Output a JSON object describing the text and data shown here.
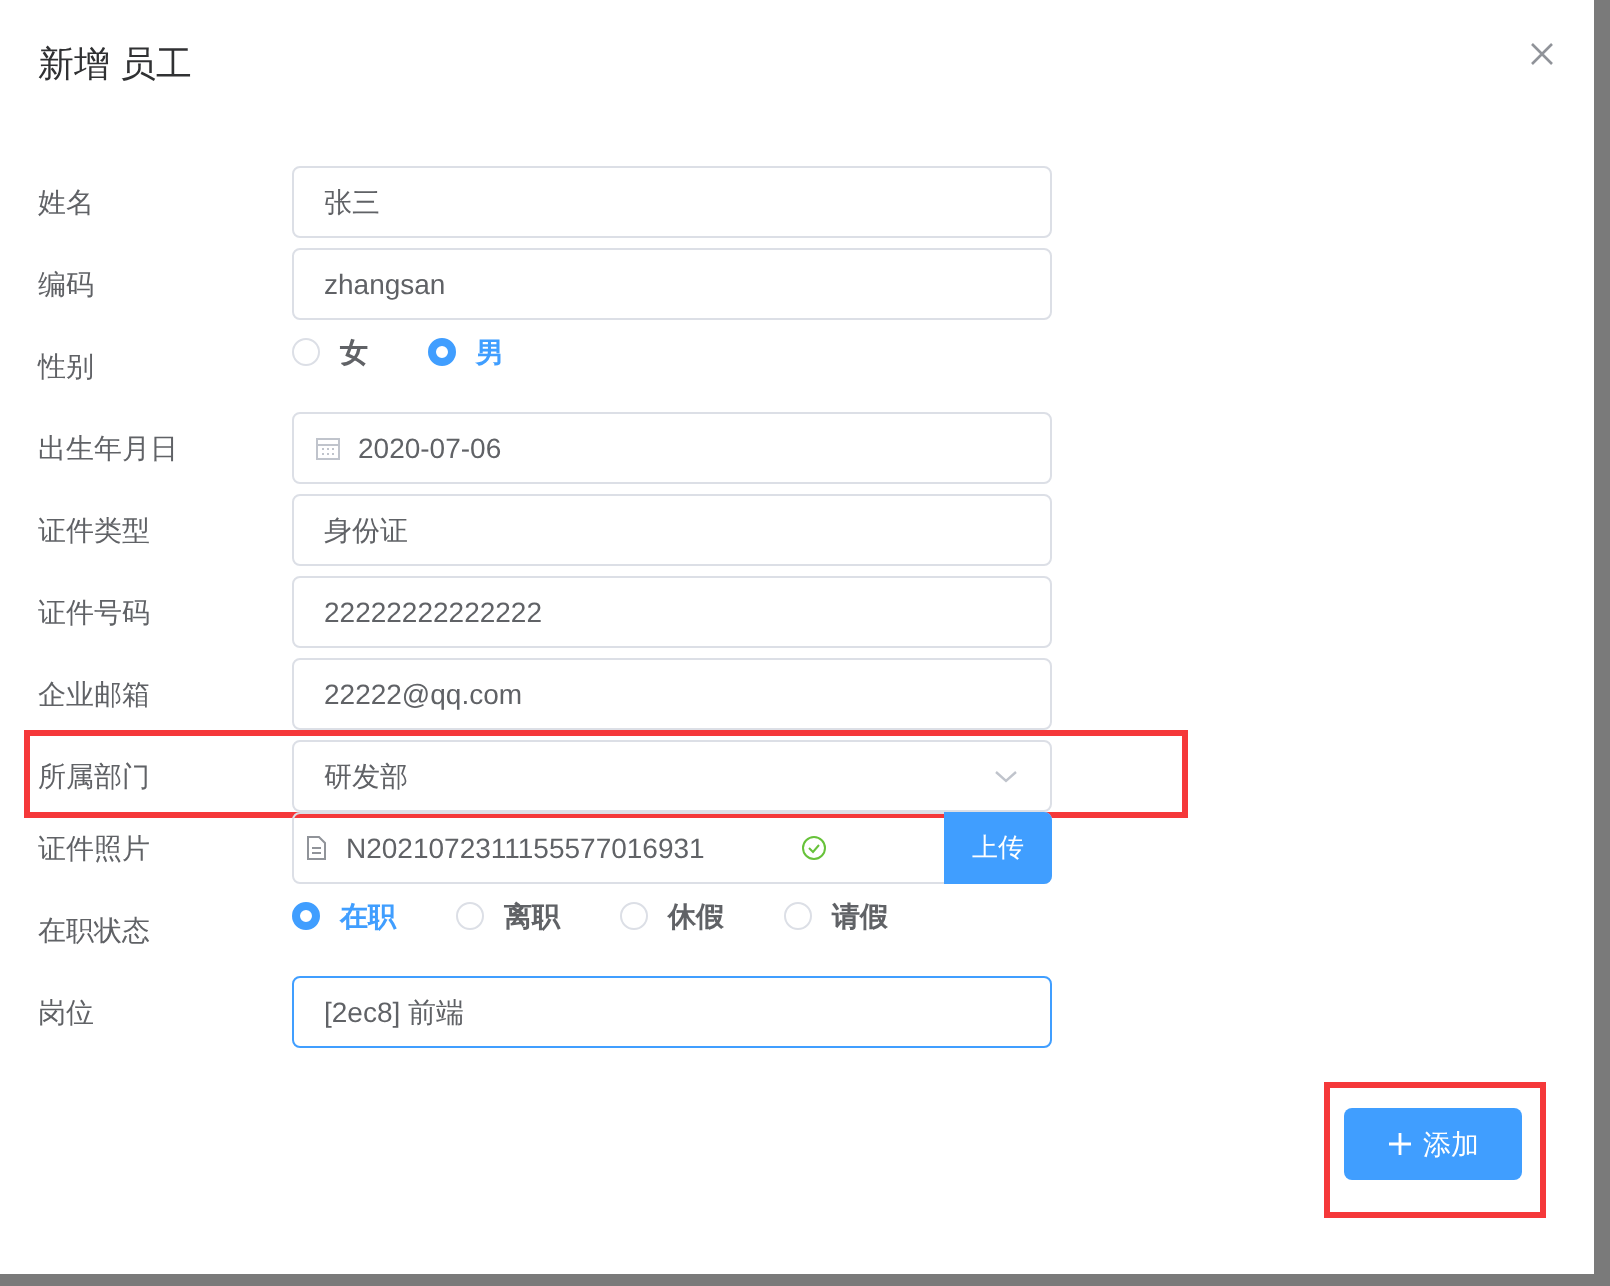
{
  "dialog": {
    "title": "新增 员工"
  },
  "fields": [
    {
      "kind": "input",
      "label": "姓名",
      "value": "张三"
    },
    {
      "kind": "input",
      "label": "编码",
      "value": "zhangsan"
    },
    {
      "kind": "radio",
      "label": "性别",
      "options": [
        {
          "label": "女",
          "selected": false
        },
        {
          "label": "男",
          "selected": true
        }
      ]
    },
    {
      "kind": "date",
      "label": "出生年月日",
      "value": "2020-07-06"
    },
    {
      "kind": "input",
      "label": "证件类型",
      "value": "身份证"
    },
    {
      "kind": "input",
      "label": "证件号码",
      "value": "22222222222222"
    },
    {
      "kind": "input",
      "label": "企业邮箱",
      "value": "22222@qq.com"
    },
    {
      "kind": "select",
      "label": "所属部门",
      "value": "研发部",
      "highlighted": true
    },
    {
      "kind": "upload",
      "label": "证件照片",
      "value": "N2021072311155577016931",
      "uploaded": true,
      "button": "上传"
    },
    {
      "kind": "radio",
      "label": "在职状态",
      "options": [
        {
          "label": "在职",
          "selected": true
        },
        {
          "label": "离职",
          "selected": false
        },
        {
          "label": "休假",
          "selected": false
        },
        {
          "label": "请假",
          "selected": false
        }
      ]
    },
    {
      "kind": "input",
      "label": "岗位",
      "value": "[2ec8] 前端",
      "focused": true
    }
  ],
  "submit": {
    "label": "添加",
    "highlighted": true
  }
}
